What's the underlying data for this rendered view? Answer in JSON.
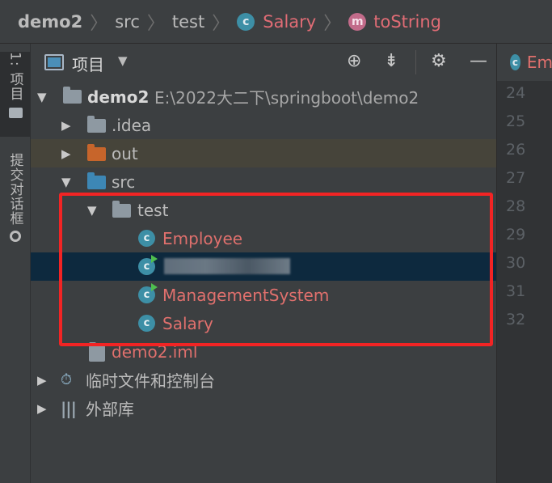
{
  "breadcrumb": {
    "project": "demo2",
    "dir1": "src",
    "dir2": "test",
    "class_badge": "c",
    "class_name": "Salary",
    "method_badge": "m",
    "method_name": "toString",
    "separator": "〉"
  },
  "strip": {
    "project_tab": "1: 项目",
    "commit_tab": "提交对话框"
  },
  "panel": {
    "view_mode": "项目",
    "icons": [
      "locate-icon",
      "collapse-icon",
      "settings-icon",
      "hide-icon"
    ]
  },
  "tree": {
    "root_name": "demo2",
    "root_path": "E:\\2022大二下\\springboot\\demo2",
    "idea": ".idea",
    "out": "out",
    "src": "src",
    "test": "test",
    "employee": "Employee",
    "blurred_item": "",
    "management": "ManagementSystem",
    "salary": "Salary",
    "iml": "demo2.iml",
    "scratches": "临时文件和控制台",
    "libraries": "外部库",
    "class_badge": "c"
  },
  "editor": {
    "tab_badge": "c",
    "tab_label": "Em",
    "line_numbers": [
      "24",
      "25",
      "26",
      "27",
      "28",
      "29",
      "30",
      "31",
      "32"
    ]
  },
  "colors": {
    "background": "#3c3f41",
    "selection": "#0d293e",
    "class_text": "#e0706d",
    "highlight_border": "#f22424"
  }
}
